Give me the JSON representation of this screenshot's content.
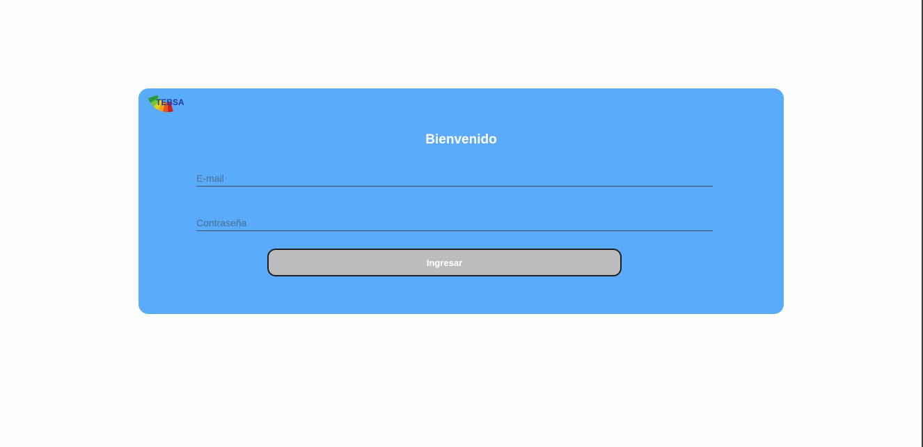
{
  "brand": {
    "logo_text": "TEBSA",
    "logo_colors": {
      "text": "#1f3f9a",
      "arc": [
        "#2a9a3e",
        "#7cc43a",
        "#e5d21b",
        "#f2a21a",
        "#e8541f",
        "#c81e25"
      ]
    }
  },
  "login": {
    "title": "Bienvenido",
    "email_placeholder": "E-mail",
    "email_value": "",
    "password_placeholder": "Contraseña",
    "password_value": "",
    "submit_label": "Ingresar"
  },
  "colors": {
    "card_background": "#5aabf9",
    "button_background": "#bcbbbd",
    "title_text": "#ffffff"
  }
}
